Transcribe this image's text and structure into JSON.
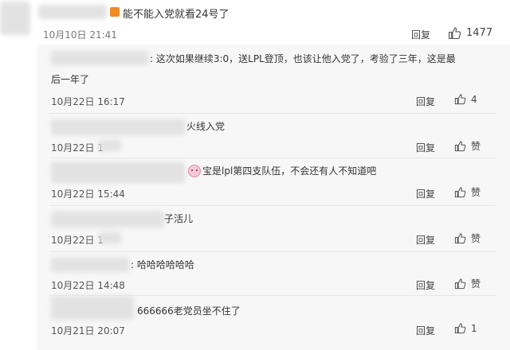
{
  "top_comment": {
    "text": "能不能入党就看24号了",
    "time": "10月10日 21:41",
    "reply": "回复",
    "likes": "1477"
  },
  "replies": [
    {
      "text_line1": ": 这次如果继续3:0，送LPL登顶，也该让他入党了，考验了三年，这是最",
      "text_line2": "后一年了",
      "time": "10月22日 16:17",
      "reply": "回复",
      "likes": "4"
    },
    {
      "text": "火线入党",
      "time": "10月22日 1",
      "reply": "回复",
      "likes": "赞"
    },
    {
      "text": "宝是lpl第四支队伍，不会还有人不知道吧",
      "time": "10月22日 15:44",
      "reply": "回复",
      "likes": "赞"
    },
    {
      "text": "子活儿",
      "time": "10月22日 1",
      "reply": "回复",
      "likes": "赞"
    },
    {
      "text": ": 哈哈哈哈哈哈",
      "time": "10月22日 14:48",
      "reply": "回复",
      "likes": "赞"
    },
    {
      "text": "666666老党员坐不住了",
      "time": "10月21日 20:07",
      "reply": "回复",
      "likes": "1"
    }
  ]
}
